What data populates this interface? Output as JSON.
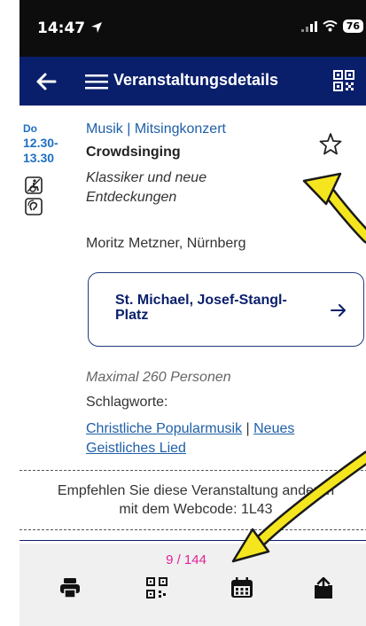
{
  "status_bar": {
    "time": "14:47",
    "battery": "76"
  },
  "nav": {
    "title": "Veranstaltungsdetails"
  },
  "event": {
    "day": "Do",
    "time_start": "12.30-",
    "time_end": "13.30",
    "category": "Musik | Mitsingkonzert",
    "title": "Crowdsinging",
    "subtitle": "Klassiker und neue Entdeckungen",
    "performer": "Moritz Metzner, Nürnberg",
    "venue": "St. Michael, Josef-Stangl-Platz",
    "capacity": "Maximal 260 Personen",
    "tags_label": "Schlagworte:",
    "tags": [
      "Christliche Popularmusik",
      "Neues Geistliches Lied"
    ],
    "tag_separator": " | ",
    "recommend_line1": "Empfehlen Sie diese Veranstaltung anderen",
    "recommend_line2": "mit dem Webcode: 1L43"
  },
  "pager": {
    "text": "9 / 144"
  },
  "icons": {
    "back": "arrow-left-icon",
    "menu": "hamburger-menu-icon",
    "qr": "qr-code-icon",
    "star": "star-outline-icon",
    "accessibility": [
      "wheelchair-toilet-icon",
      "hearing-loop-icon"
    ],
    "toolbar": [
      "print-icon",
      "qr-code-icon",
      "calendar-icon",
      "share-icon"
    ]
  },
  "colors": {
    "nav_bg": "#0a1f6b",
    "link": "#1f5fa8",
    "pager": "#e0249a",
    "annotation_arrow": "#f5e51f"
  }
}
